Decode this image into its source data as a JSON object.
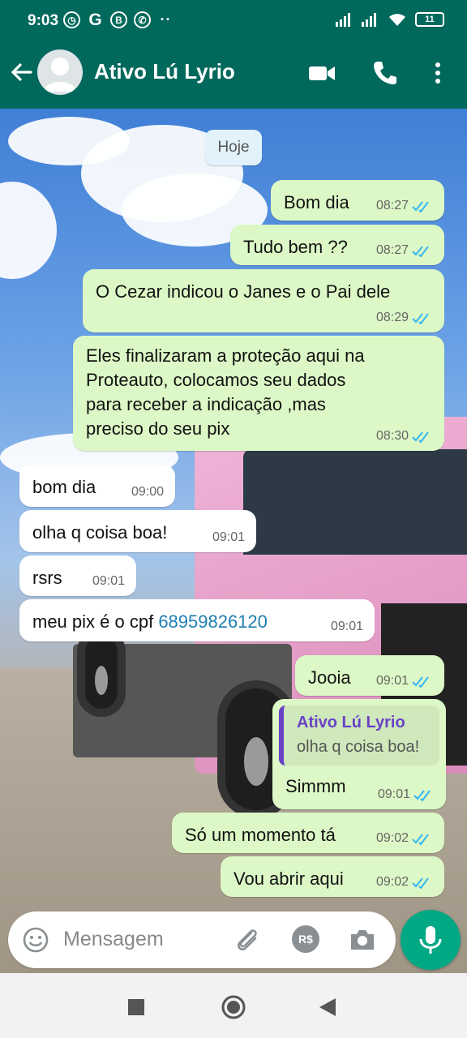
{
  "status_bar": {
    "time": "9:03",
    "battery": "11",
    "icons": [
      "alarm-icon",
      "google-icon",
      "b-icon",
      "whatsapp-icon",
      "more-dots-icon",
      "signal-icon",
      "signal-icon",
      "wifi-icon",
      "battery-icon"
    ]
  },
  "header": {
    "contact_name": "Ativo Lú Lyrio",
    "icons": [
      "back-arrow-icon",
      "avatar",
      "video-call-icon",
      "voice-call-icon",
      "more-options-icon"
    ]
  },
  "chat": {
    "date_label": "Hoje",
    "messages": [
      {
        "dir": "out",
        "text": "Bom dia",
        "time": "08:27",
        "status": "read"
      },
      {
        "dir": "out",
        "text": "Tudo bem ??",
        "time": "08:27",
        "status": "read"
      },
      {
        "dir": "out",
        "text": "O Cezar indicou o Janes e o Pai dele",
        "time": "08:29",
        "status": "read"
      },
      {
        "dir": "out",
        "lines": [
          "Eles finalizaram a proteção aqui na",
          "Proteauto, colocamos seu dados",
          "para receber a indicação ,mas",
          "preciso do seu pix"
        ],
        "time": "08:30",
        "status": "read"
      },
      {
        "dir": "in",
        "text": "bom dia",
        "time": "09:00"
      },
      {
        "dir": "in",
        "text": "olha q coisa boa!",
        "time": "09:01"
      },
      {
        "dir": "in",
        "text": "rsrs",
        "time": "09:01"
      },
      {
        "dir": "in",
        "text_prefix": "meu pix é o cpf ",
        "phone": "68959826120",
        "time": "09:01"
      },
      {
        "dir": "out",
        "text": "Jooia",
        "time": "09:01",
        "status": "read"
      },
      {
        "dir": "out",
        "quote_name": "Ativo Lú Lyrio",
        "quote_text": "olha q coisa boa!",
        "text": "Simmm",
        "time": "09:01",
        "status": "read"
      },
      {
        "dir": "out",
        "text": "Só um momento tá",
        "time": "09:02",
        "status": "read"
      },
      {
        "dir": "out",
        "text": "Vou abrir aqui",
        "time": "09:02",
        "status": "read"
      }
    ]
  },
  "input": {
    "placeholder": "Mensagem",
    "rs_label": "R$",
    "icons": [
      "emoji-icon",
      "attach-icon",
      "payment-icon",
      "camera-icon",
      "mic-icon"
    ]
  },
  "colors": {
    "header": "#00695c",
    "outgoing_bubble": "#dcf8c6",
    "incoming_bubble": "#ffffff",
    "read_ticks": "#34b7f1",
    "mic_button": "#00a884",
    "quote_accent": "#6a41c5"
  }
}
